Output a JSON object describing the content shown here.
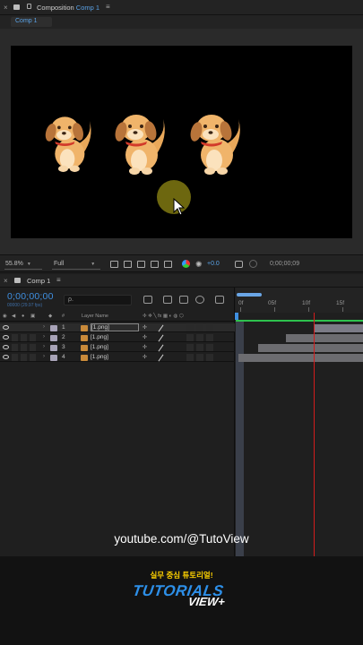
{
  "composition_panel": {
    "close": "×",
    "title_prefix": "Composition",
    "title_comp": "Comp 1",
    "menu": "≡",
    "tab": "Comp 1"
  },
  "viewer_toolbar": {
    "zoom": "55.8%",
    "quality": "Full",
    "exposure": "+0.0",
    "timecode": "0;00;00;09"
  },
  "timeline_panel": {
    "close": "×",
    "title": "Comp 1",
    "menu": "≡",
    "current_time": "0;00;00;00",
    "fps_info": "00000 (29.97 fps)",
    "search_placeholder": "ρ.",
    "col_number": "#",
    "col_layer_name": "Layer Name",
    "ruler_labels": [
      "0f",
      "05f",
      "10f",
      "15f"
    ]
  },
  "layers": [
    {
      "num": "1",
      "name": "[1.png]",
      "selected": true
    },
    {
      "num": "2",
      "name": "[1.png]",
      "selected": false
    },
    {
      "num": "3",
      "name": "[1.png]",
      "selected": false
    },
    {
      "num": "4",
      "name": "[1.png]",
      "selected": false
    }
  ],
  "overlay": {
    "youtube": "youtube.com/@TutoView",
    "banner_sub": "실무 중심 튜토리얼!",
    "logo_line1": "TUTORIALS",
    "logo_line2": "VIEW+"
  },
  "colors": {
    "accent_blue": "#3f8fe0",
    "playhead_red": "#d21c1c",
    "work_area_green": "#2ec24e",
    "banner_yellow": "#ffd200"
  }
}
